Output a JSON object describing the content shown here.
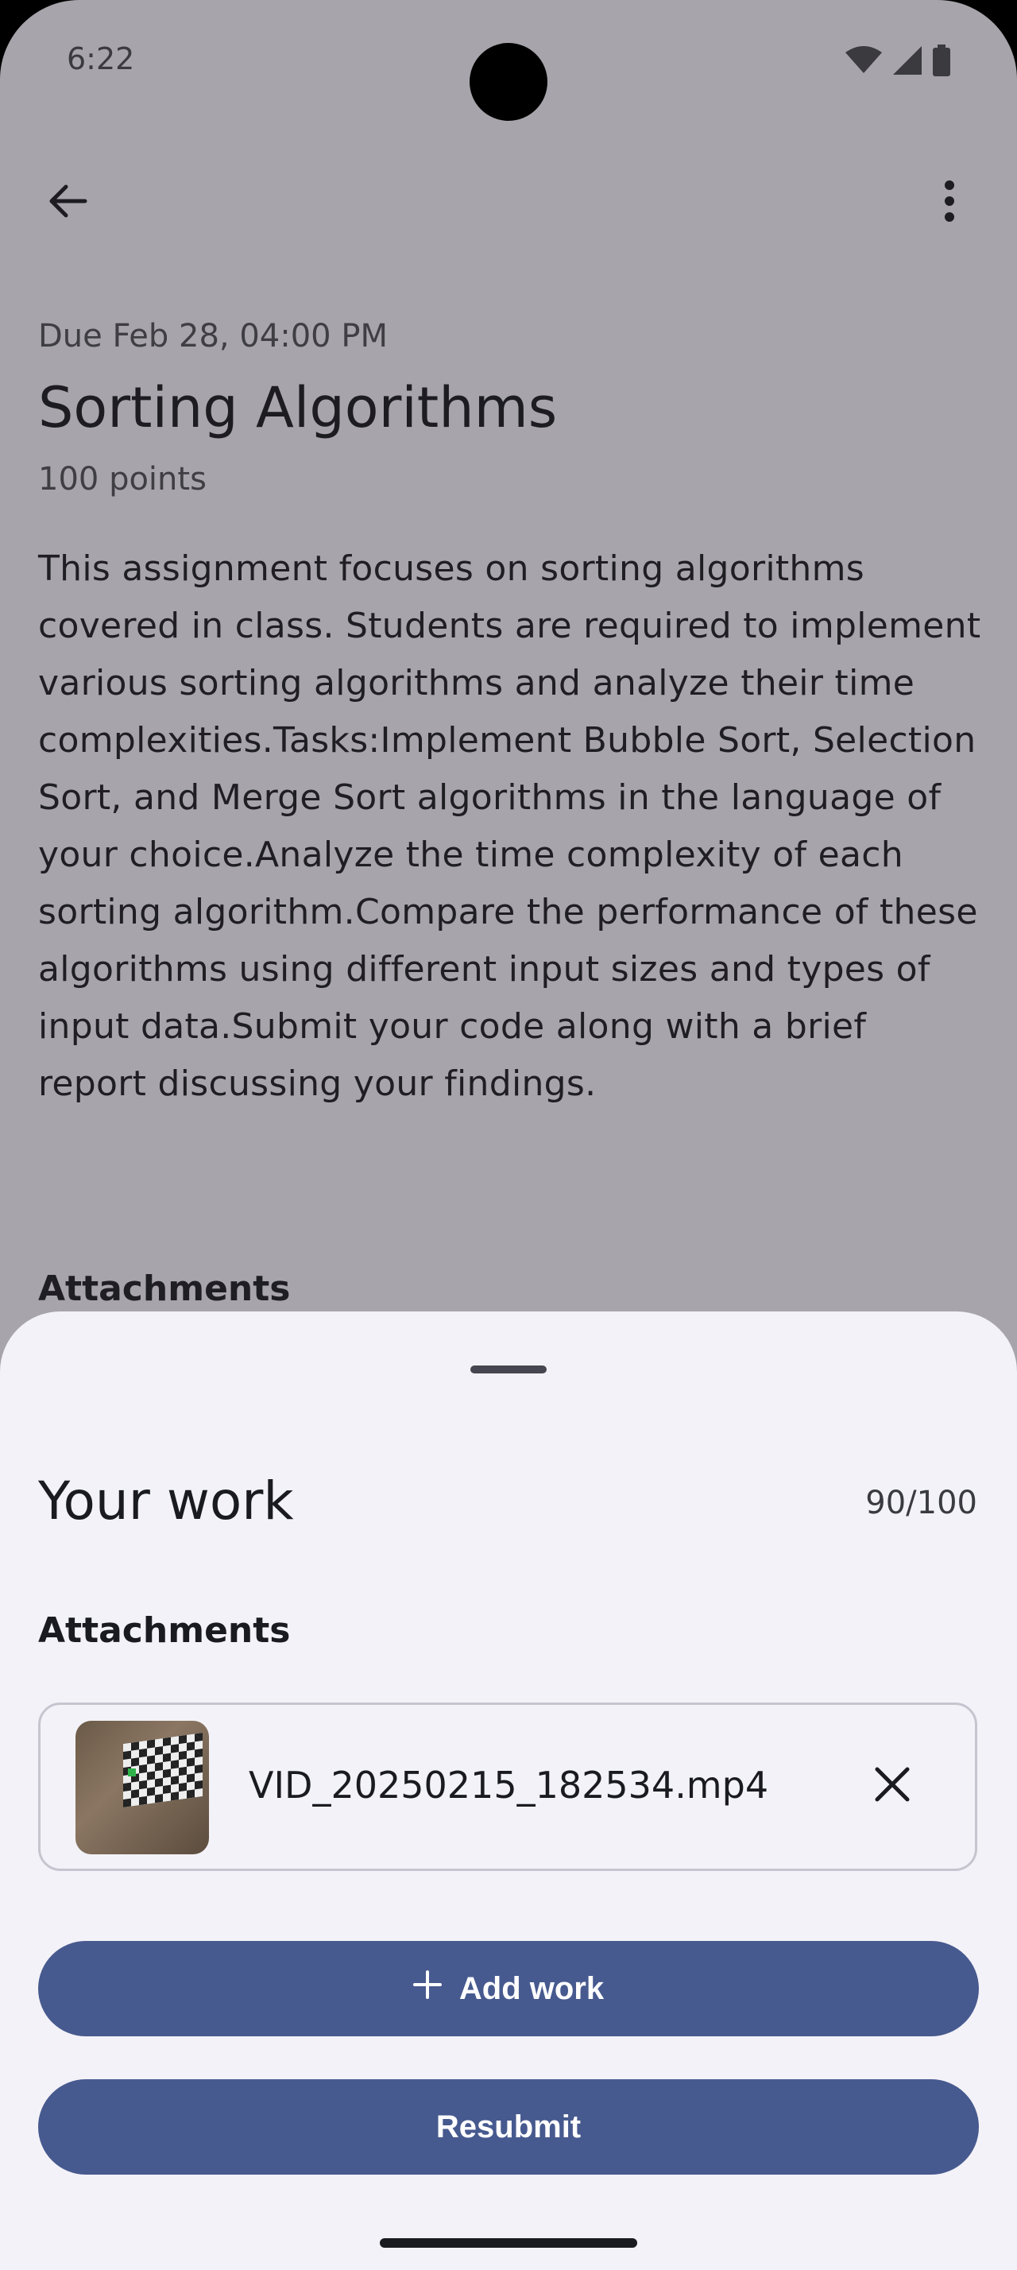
{
  "status_bar": {
    "time": "6:22",
    "icons": [
      "wifi-icon",
      "signal-icon",
      "battery-icon"
    ]
  },
  "app_bar": {
    "back_icon": "arrow-back-icon",
    "more_icon": "more-vertical-icon"
  },
  "assignment": {
    "due": "Due Feb 28, 04:00 PM",
    "title": "Sorting Algorithms",
    "points": "100 points",
    "description": "This assignment focuses on sorting algorithms covered in class. Students are required to implement various sorting algorithms and analyze their time complexities.Tasks:Implement Bubble Sort, Selection Sort, and Merge Sort algorithms in the language of your choice.Analyze the time complexity of each sorting algorithm.Compare the performance of these algorithms using different input sizes and types of input data.Submit your code along with a brief report discussing your findings.",
    "attachments_heading": "Attachments"
  },
  "sheet": {
    "title": "Your work",
    "grade": "90/100",
    "attachments_heading": "Attachments",
    "attachment": {
      "file_name": "VID_20250215_182534.mp4",
      "close_icon": "close-icon"
    },
    "add_work_label": "Add work",
    "add_icon": "plus-icon",
    "resubmit_label": "Resubmit"
  },
  "colors": {
    "scrim_background": "#a7a5ab",
    "sheet_background": "#f3f2f8",
    "primary_button": "#475a8f"
  }
}
